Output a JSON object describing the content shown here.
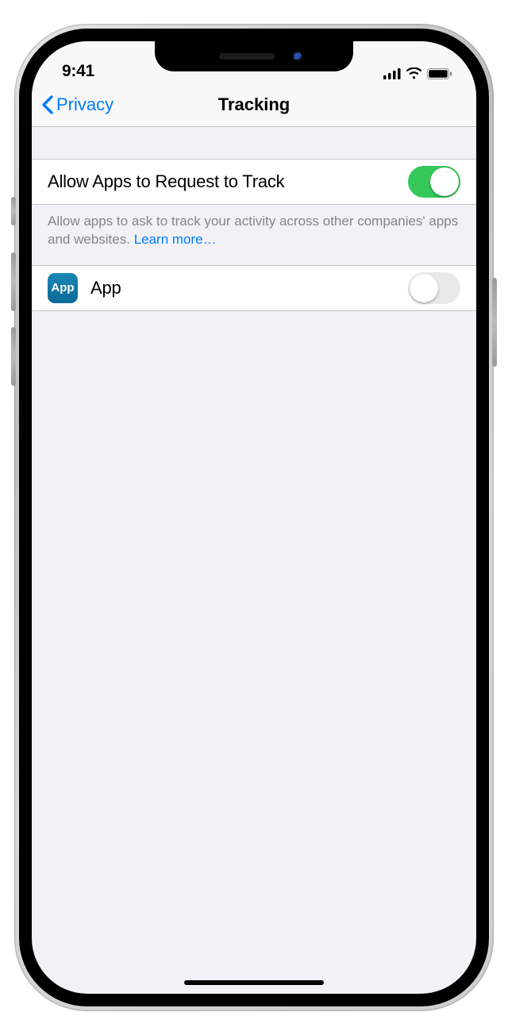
{
  "statusBar": {
    "time": "9:41"
  },
  "nav": {
    "back": "Privacy",
    "title": "Tracking"
  },
  "allowRow": {
    "label": "Allow Apps to Request to Track",
    "value": true
  },
  "footer": {
    "text": "Allow apps to ask to track your activity across other companies' apps and websites. ",
    "link": "Learn more…"
  },
  "appList": [
    {
      "name": "App",
      "iconText": "App",
      "value": false
    }
  ]
}
